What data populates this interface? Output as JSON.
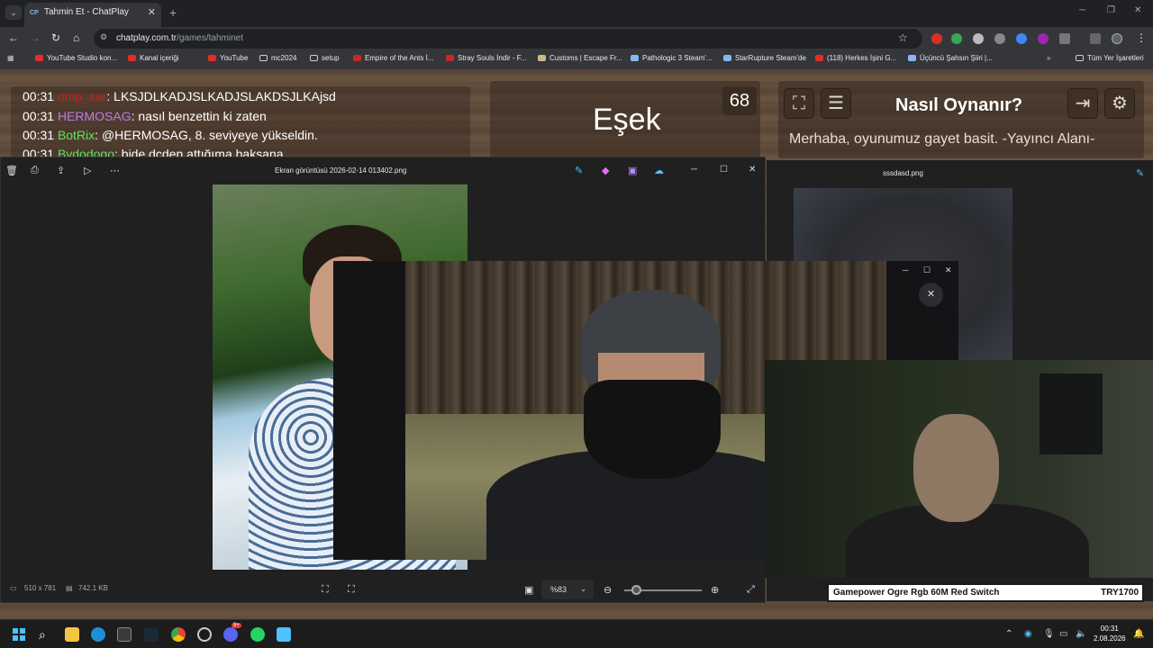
{
  "browser": {
    "tab_title": "Tahmin Et - ChatPlay",
    "tab_favicon": "CP",
    "url_domain": "chatplay.com.tr",
    "url_path": "/games/tahminet",
    "bookmarks": [
      "YouTube Studio kon...",
      "Kanal içeriği",
      "YouTube",
      "mc2024",
      "setup",
      "Empire of the Ants İ...",
      "Stray Souls İndir - F...",
      "Customs | Escape Fr...",
      "Pathologic 3 Steam'...",
      "StarRupture Steam'de",
      "(118) Herkes İşini G...",
      "Üçüncü Şahsın Şiiri |..."
    ],
    "all_bookmarks": "Tüm Yer İşaretleri"
  },
  "chat": {
    "lines": [
      {
        "time": "00:31",
        "user": "omp_ser",
        "color": "#c81e1e",
        "msg": ": LKSJDLKADJSLKADJSLAKDSJLKAjsd"
      },
      {
        "time": "00:31",
        "user": "HERMOSAG",
        "color": "#b77be0",
        "msg": ": nasıl benzettin ki zaten"
      },
      {
        "time": "00:31",
        "user": "BotRix",
        "color": "#5fe05f",
        "msg": ": @HERMOSAG, 8. seviyeye yükseldin."
      },
      {
        "time": "00:31",
        "user": "Bydodogo",
        "color": "#5fe05f",
        "msg": ": bide dcden attığıma baksana"
      }
    ]
  },
  "game": {
    "word": "Eşek",
    "counter": "68",
    "howto_title": "Nasıl Oynanır?",
    "howto_text": "Merhaba, oyunumuz gayet basit. -Yayıncı Alanı-"
  },
  "viewer1": {
    "filename": "Ekran görüntüsü 2026-02-14 013402.png",
    "dimensions": "510 x 781",
    "filesize": "742.1 KB",
    "zoom": "%83"
  },
  "viewer2": {
    "filename": "sssdasd.png"
  },
  "ticker": {
    "left": "Gamepower Ogre Rgb 60M Red Switch",
    "right": "TRY1700"
  },
  "taskbar": {
    "time": "00:31",
    "date": "2.08.2026",
    "discord_badge": "9+"
  },
  "colors": {
    "wood": "#5e4a39",
    "chrome_bg": "#35363a",
    "accent": "#4cc2ff"
  }
}
